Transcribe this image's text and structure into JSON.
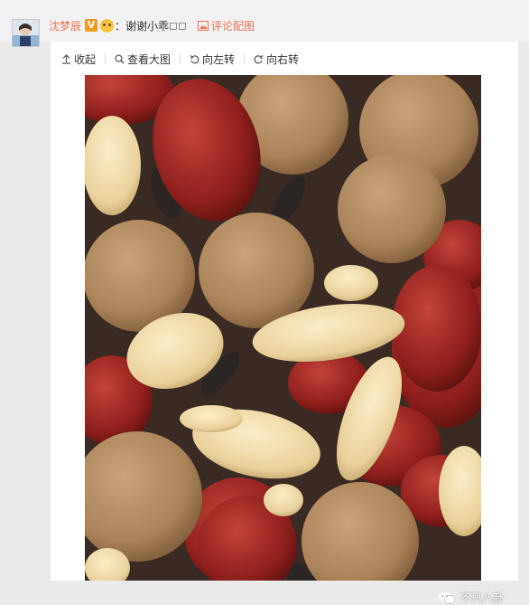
{
  "comment": {
    "username": "沈梦辰",
    "badge": "V",
    "text": "：谢谢小乖",
    "tail_glyphs": "◻◻",
    "image_link": "评论配图"
  },
  "toolbar": {
    "collapse": "收起",
    "view_large": "查看大图",
    "rotate_left": "向左转",
    "rotate_right": "向右转"
  },
  "watermark": {
    "text": "不只八卦"
  },
  "colors": {
    "accent": "#eb7350",
    "badge": "#f39a1e",
    "background": "#eaeaea"
  },
  "icons": [
    "arrow-up-icon",
    "search-icon",
    "rotate-left-icon",
    "rotate-right-icon",
    "image-icon",
    "wechat-icon"
  ]
}
